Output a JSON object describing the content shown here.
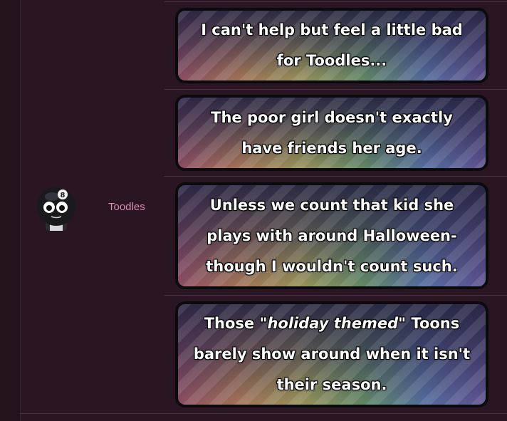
{
  "post": {
    "username": "Toodles",
    "avatar": "toodles-avatar"
  },
  "messages": [
    {
      "text": "I can't help but feel a little bad for Toodles..."
    },
    {
      "text": "The poor girl doesn't exactly have friends her age."
    },
    {
      "text": "Unless we count that kid she plays with around Halloween- though I wouldn't count such."
    },
    {
      "text_before": "Those ",
      "text_emphasis": "\"holiday themed\"",
      "text_after": " Toons barely show around when it isn't their season."
    }
  ]
}
